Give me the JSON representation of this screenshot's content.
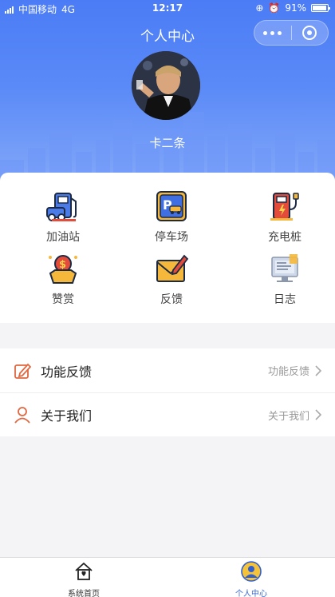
{
  "status_bar": {
    "carrier": "中国移动",
    "network": "4G",
    "time": "12:17",
    "battery": "91%"
  },
  "navbar": {
    "title": "个人中心"
  },
  "profile": {
    "name": "卡二条"
  },
  "grid": [
    {
      "label": "加油站",
      "icon": "gas-station-icon"
    },
    {
      "label": "停车场",
      "icon": "parking-icon"
    },
    {
      "label": "充电桩",
      "icon": "charging-pile-icon"
    },
    {
      "label": "赞赏",
      "icon": "reward-icon"
    },
    {
      "label": "反馈",
      "icon": "feedback-envelope-icon"
    },
    {
      "label": "日志",
      "icon": "log-icon"
    }
  ],
  "list": [
    {
      "title": "功能反馈",
      "sub": "功能反馈",
      "icon": "edit-icon"
    },
    {
      "title": "关于我们",
      "sub": "关于我们",
      "icon": "user-icon"
    }
  ],
  "tabbar": [
    {
      "label": "系统首页",
      "icon": "home-icon"
    },
    {
      "label": "个人中心",
      "icon": "profile-icon",
      "active": true
    }
  ],
  "colors": {
    "accent": "#4b7cf6",
    "tab_active": "#3a68d8"
  }
}
